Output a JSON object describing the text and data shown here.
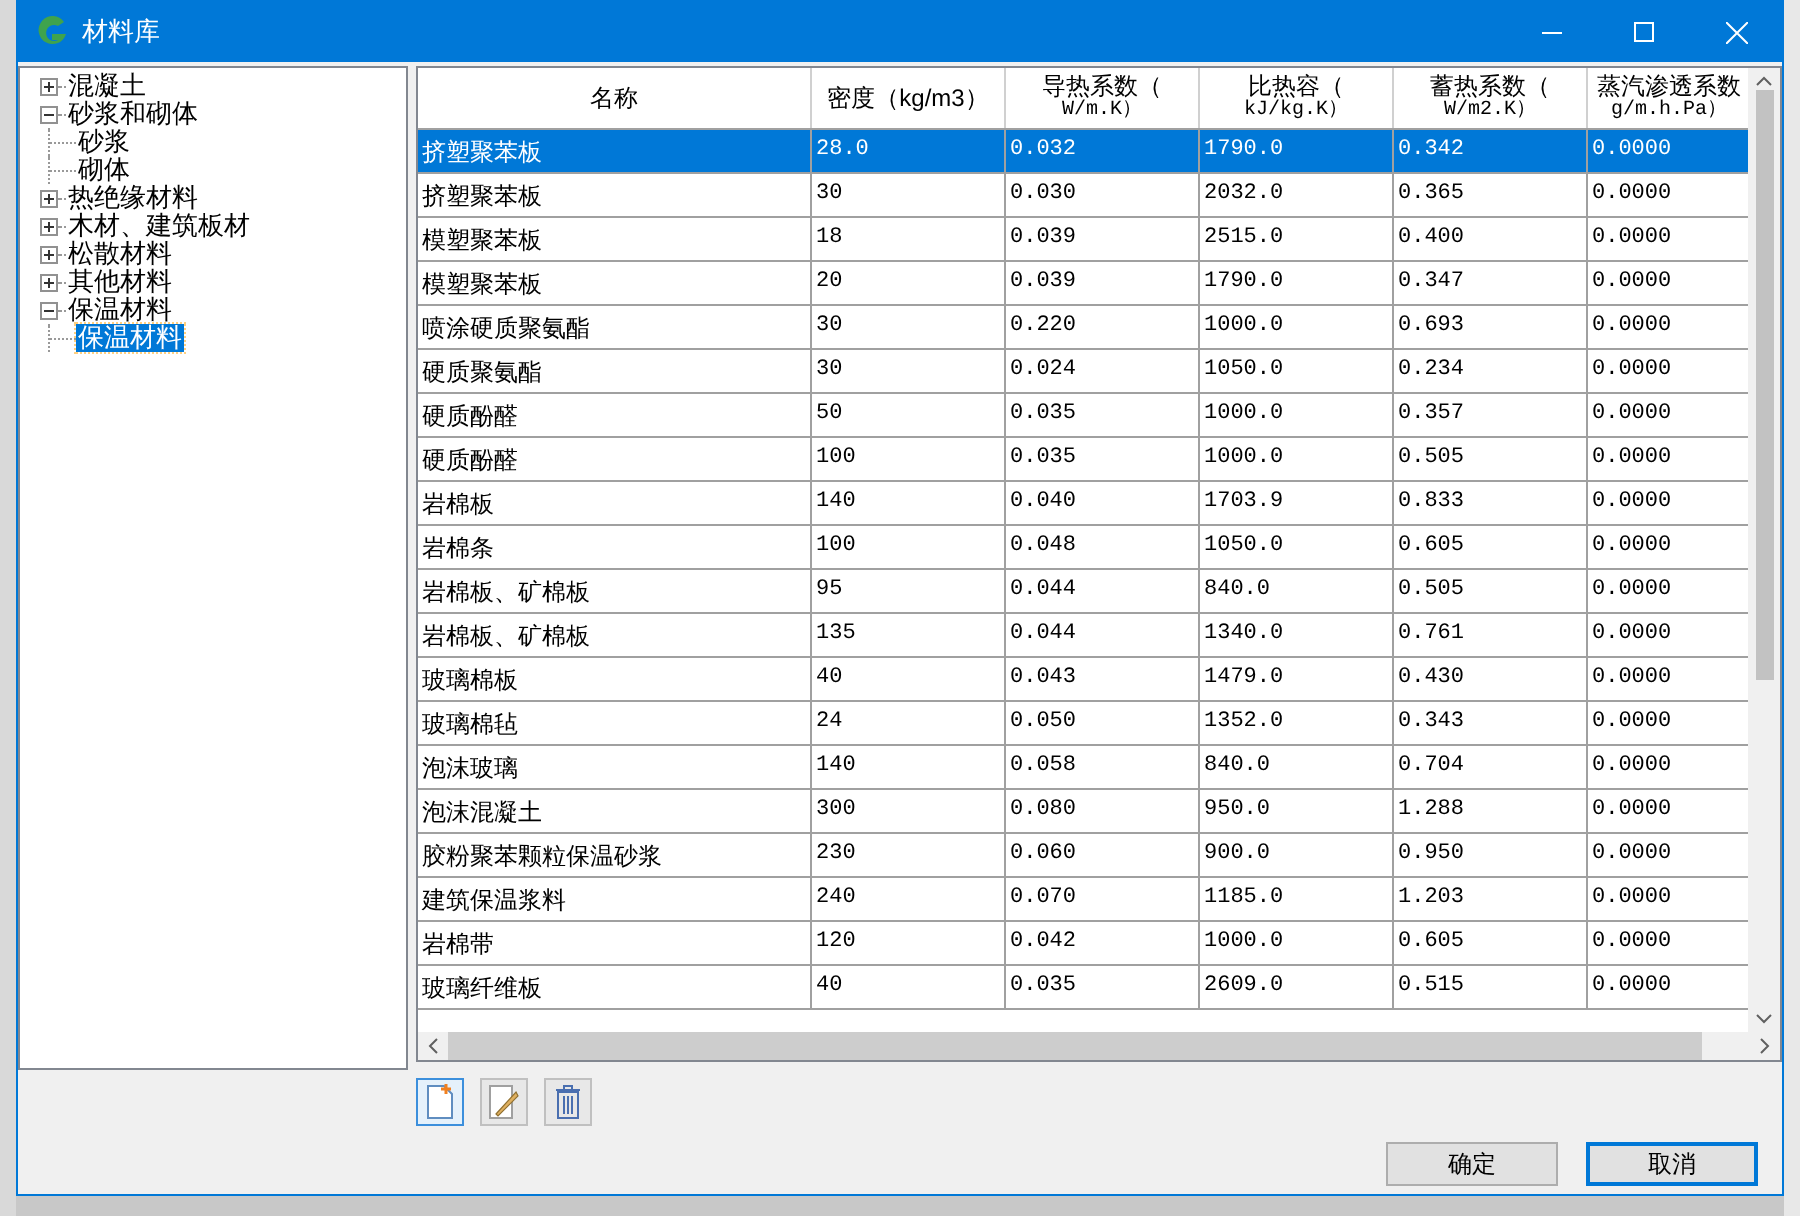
{
  "window": {
    "title": "材料库"
  },
  "tree": [
    {
      "label": "混凝土",
      "expanded": false,
      "selected": false
    },
    {
      "label": "砂浆和砌体",
      "expanded": true,
      "selected": false,
      "children": [
        {
          "label": "砂浆",
          "selected": false
        },
        {
          "label": "砌体",
          "selected": false
        }
      ]
    },
    {
      "label": "热绝缘材料",
      "expanded": false,
      "selected": false
    },
    {
      "label": "木材、建筑板材",
      "expanded": false,
      "selected": false
    },
    {
      "label": "松散材料",
      "expanded": false,
      "selected": false
    },
    {
      "label": "其他材料",
      "expanded": false,
      "selected": false
    },
    {
      "label": "保温材料",
      "expanded": true,
      "selected": false,
      "children": [
        {
          "label": "保温材料",
          "selected": true
        }
      ]
    }
  ],
  "table": {
    "columns": [
      {
        "label": "名称"
      },
      {
        "label": "密度（kg/m3）"
      },
      {
        "label": "导热系数（",
        "unit": "W/m.K）"
      },
      {
        "label": "比热容（",
        "unit": "kJ/kg.K）"
      },
      {
        "label": "蓄热系数（",
        "unit": "W/m2.K）"
      },
      {
        "label": "蒸汽渗透系数",
        "unit": "g/m.h.Pa）"
      }
    ],
    "rows": [
      {
        "selected": true,
        "cells": [
          "挤塑聚苯板",
          "28.0",
          "0.032",
          "1790.0",
          "0.342",
          "0.0000"
        ]
      },
      {
        "selected": false,
        "cells": [
          "挤塑聚苯板",
          "30",
          "0.030",
          "2032.0",
          "0.365",
          "0.0000"
        ]
      },
      {
        "selected": false,
        "cells": [
          "模塑聚苯板",
          "18",
          "0.039",
          "2515.0",
          "0.400",
          "0.0000"
        ]
      },
      {
        "selected": false,
        "cells": [
          "模塑聚苯板",
          "20",
          "0.039",
          "1790.0",
          "0.347",
          "0.0000"
        ]
      },
      {
        "selected": false,
        "cells": [
          "喷涂硬质聚氨酯",
          "30",
          "0.220",
          "1000.0",
          "0.693",
          "0.0000"
        ]
      },
      {
        "selected": false,
        "cells": [
          "硬质聚氨酯",
          "30",
          "0.024",
          "1050.0",
          "0.234",
          "0.0000"
        ]
      },
      {
        "selected": false,
        "cells": [
          "硬质酚醛",
          "50",
          "0.035",
          "1000.0",
          "0.357",
          "0.0000"
        ]
      },
      {
        "selected": false,
        "cells": [
          "硬质酚醛",
          "100",
          "0.035",
          "1000.0",
          "0.505",
          "0.0000"
        ]
      },
      {
        "selected": false,
        "cells": [
          "岩棉板",
          "140",
          "0.040",
          "1703.9",
          "0.833",
          "0.0000"
        ]
      },
      {
        "selected": false,
        "cells": [
          "岩棉条",
          "100",
          "0.048",
          "1050.0",
          "0.605",
          "0.0000"
        ]
      },
      {
        "selected": false,
        "cells": [
          "岩棉板、矿棉板",
          "95",
          "0.044",
          "840.0",
          "0.505",
          "0.0000"
        ]
      },
      {
        "selected": false,
        "cells": [
          "岩棉板、矿棉板",
          "135",
          "0.044",
          "1340.0",
          "0.761",
          "0.0000"
        ]
      },
      {
        "selected": false,
        "cells": [
          "玻璃棉板",
          "40",
          "0.043",
          "1479.0",
          "0.430",
          "0.0000"
        ]
      },
      {
        "selected": false,
        "cells": [
          "玻璃棉毡",
          "24",
          "0.050",
          "1352.0",
          "0.343",
          "0.0000"
        ]
      },
      {
        "selected": false,
        "cells": [
          "泡沫玻璃",
          "140",
          "0.058",
          "840.0",
          "0.704",
          "0.0000"
        ]
      },
      {
        "selected": false,
        "cells": [
          "泡沫混凝土",
          "300",
          "0.080",
          "950.0",
          "1.288",
          "0.0000"
        ]
      },
      {
        "selected": false,
        "cells": [
          "胶粉聚苯颗粒保温砂浆",
          "230",
          "0.060",
          "900.0",
          "0.950",
          "0.0000"
        ]
      },
      {
        "selected": false,
        "cells": [
          "建筑保温浆料",
          "240",
          "0.070",
          "1185.0",
          "1.203",
          "0.0000"
        ]
      },
      {
        "selected": false,
        "cells": [
          "岩棉带",
          "120",
          "0.042",
          "1000.0",
          "0.605",
          "0.0000"
        ]
      },
      {
        "selected": false,
        "cells": [
          "玻璃纤维板",
          "40",
          "0.035",
          "2609.0",
          "0.515",
          "0.0000"
        ]
      }
    ]
  },
  "buttons": [
    {
      "label": "确定",
      "default": false
    },
    {
      "label": "取消",
      "default": true
    }
  ]
}
